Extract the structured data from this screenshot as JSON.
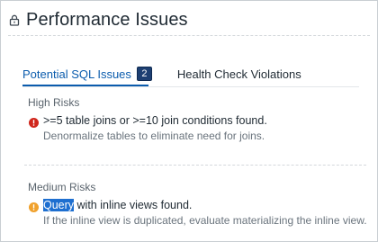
{
  "header": {
    "title": "Performance Issues",
    "icon": "lock-icon"
  },
  "tabs": [
    {
      "label": "Potential SQL Issues",
      "count": "2",
      "active": true
    },
    {
      "label": "Health Check Violations",
      "active": false
    }
  ],
  "sections": {
    "high": {
      "heading": "High Risks",
      "icon": "error-icon",
      "icon_color": "#d0271d",
      "title": ">=5 table joins or >=10 join conditions found.",
      "description": "Denormalize tables to eliminate need for joins."
    },
    "medium": {
      "heading": "Medium Risks",
      "icon": "warning-icon",
      "icon_color": "#f0a12c",
      "title_highlight": "Query",
      "title_rest": " with inline views found.",
      "description": "If the inline view is duplicated, evaluate materializing the inline view."
    }
  },
  "colors": {
    "accent": "#0b5cad",
    "badge": "#1d3f72",
    "highlight": "#1e6fd0"
  }
}
